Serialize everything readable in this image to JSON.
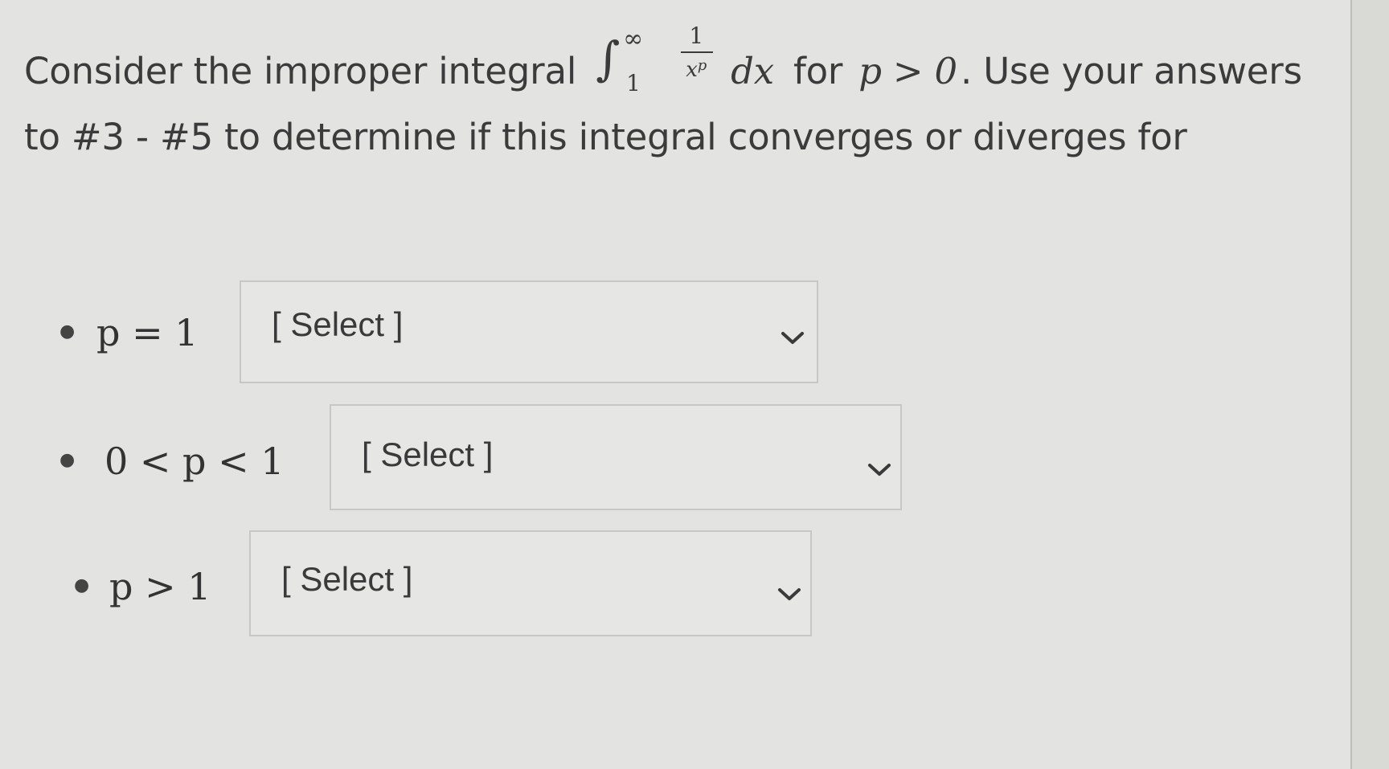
{
  "question": {
    "intro": "Consider the improper integral",
    "integral": {
      "sign": "∫",
      "upper": "∞",
      "lower": "1",
      "numerator": "1",
      "denominator_base": "x",
      "denominator_exponent": "p",
      "differential": "dx"
    },
    "for_word": "for",
    "condition": "p > 0",
    "outro": ". Use your answers to #3 - #5 to determine if this integral converges or diverges for"
  },
  "options": [
    {
      "condition": "p = 1",
      "select_value": "[ Select ]"
    },
    {
      "condition": "0 < p < 1",
      "select_value": "[ Select ]"
    },
    {
      "condition": "p > 1",
      "select_value": "[ Select ]"
    }
  ]
}
